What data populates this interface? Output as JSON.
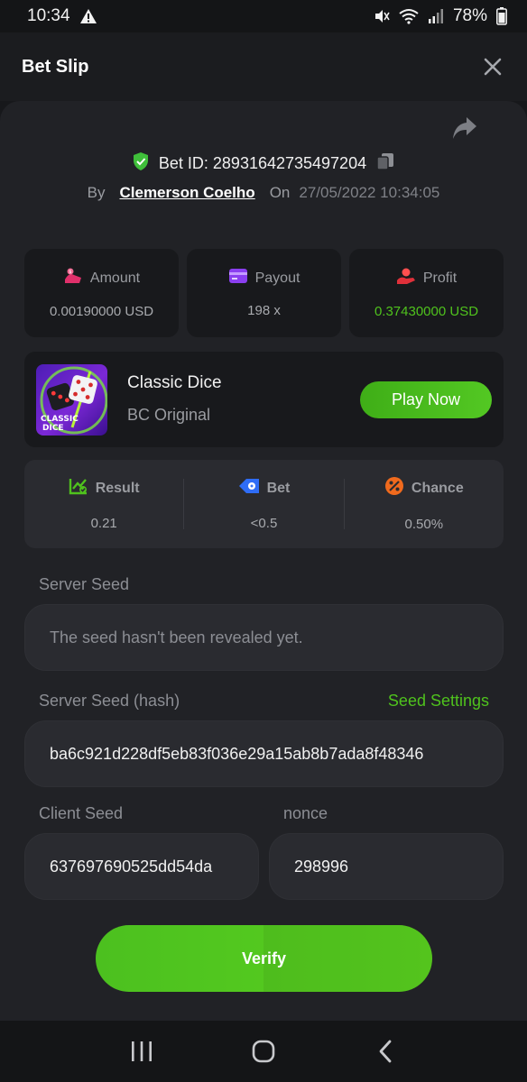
{
  "status_bar": {
    "time": "10:34",
    "battery": "78%"
  },
  "header": {
    "title": "Bet Slip"
  },
  "bet": {
    "id_label": "Bet ID: 28931642735497204",
    "by_label": "By",
    "author": "Clemerson Coelho",
    "on_label": "On",
    "date": "27/05/2022 10:34:05"
  },
  "stats": [
    {
      "label": "Amount",
      "value": "0.00190000 USD",
      "icon": "amount-icon"
    },
    {
      "label": "Payout",
      "value": "198 x",
      "icon": "payout-icon"
    },
    {
      "label": "Profit",
      "value": "0.37430000 USD",
      "icon": "profit-icon"
    }
  ],
  "game": {
    "name": "Classic Dice",
    "subtitle": "BC Original",
    "thumb_text_1": "CLASSIC",
    "thumb_text_2": "DICE",
    "play_label": "Play Now"
  },
  "info": [
    {
      "label": "Result",
      "value": "0.21",
      "icon": "result-icon"
    },
    {
      "label": "Bet",
      "value": "<0.5",
      "icon": "bet-icon"
    },
    {
      "label": "Chance",
      "value": "0.50%",
      "icon": "chance-icon"
    }
  ],
  "seeds": {
    "server_seed_label": "Server Seed",
    "server_seed_value": "The seed hasn't been revealed yet.",
    "server_hash_label": "Server Seed (hash)",
    "seed_settings_label": "Seed Settings",
    "server_hash_value": "ba6c921d228df5eb83f036e29a15ab8b7ada8f48346",
    "client_seed_label": "Client Seed",
    "client_seed_value": "637697690525dd54da",
    "nonce_label": "nonce",
    "nonce_value": "298996"
  },
  "verify_label": "Verify",
  "colors": {
    "accent_green": "#4fc21d",
    "background": "#17181b",
    "card": "#18191c"
  }
}
